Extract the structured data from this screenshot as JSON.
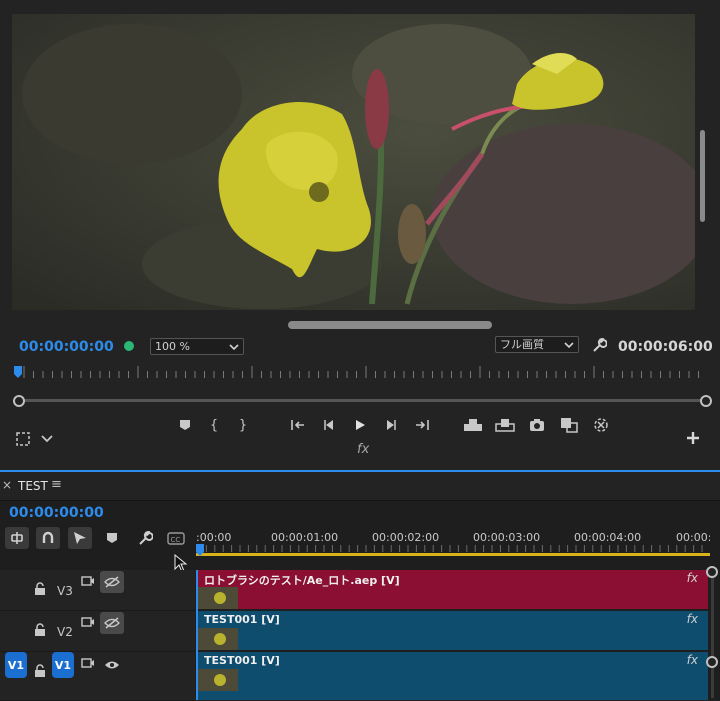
{
  "program_monitor": {
    "current_timecode": "00:00:00:00",
    "zoom_value": "100 %",
    "resolution_value": "フル画質",
    "duration_timecode": "00:00:06:00",
    "fx_label": "fx"
  },
  "timeline": {
    "sequence_name": "TEST",
    "close_glyph": "×",
    "menu_glyph": "≡",
    "playhead_timecode": "00:00:00:00",
    "ruler_labels": [
      ":00:00",
      "00:00:01:00",
      "00:00:02:00",
      "00:00:03:00",
      "00:00:04:00",
      "00:00:0"
    ],
    "tracks": [
      {
        "name": "V3",
        "clip_label": "ロトブラシのテスト/Ae_ロト.aep [V]",
        "clip_fx": "fx",
        "clip_color": "#8a0f33"
      },
      {
        "name": "V2",
        "clip_label": "TEST001 [V]",
        "clip_fx": "fx",
        "clip_color": "#0f4d6e"
      },
      {
        "name": "V1",
        "source_label": "V1",
        "clip_label": "TEST001 [V]",
        "clip_fx": "fx",
        "clip_color": "#0f4d6e"
      }
    ]
  },
  "colors": {
    "accent": "#2d8ceb",
    "record_dot": "#2bb673",
    "work_area": "#d8b31a"
  },
  "icons": [
    "marker-icon",
    "in-point-icon",
    "out-point-icon",
    "go-to-in-icon",
    "step-back-icon",
    "play-icon",
    "step-forward-icon",
    "go-to-out-icon",
    "insert-icon",
    "overwrite-icon",
    "export-frame-icon",
    "compare-icon",
    "vr-icon",
    "add-button-icon",
    "wrench-icon",
    "safe-margins-icon",
    "snap-icon",
    "linked-selection-icon",
    "captions-icon",
    "lock-icon",
    "camera-icon",
    "eye-icon",
    "eye-off-icon"
  ]
}
